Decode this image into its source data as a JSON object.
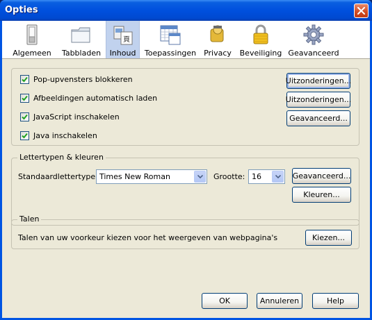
{
  "window": {
    "title": "Opties"
  },
  "tabs": [
    {
      "label": "Algemeen",
      "icon": "switch-icon"
    },
    {
      "label": "Tabbladen",
      "icon": "folder-icon"
    },
    {
      "label": "Inhoud",
      "icon": "content-icon",
      "selected": true
    },
    {
      "label": "Toepassingen",
      "icon": "calendar-icon"
    },
    {
      "label": "Privacy",
      "icon": "mask-icon"
    },
    {
      "label": "Beveiliging",
      "icon": "lock-icon"
    },
    {
      "label": "Geavanceerd",
      "icon": "gear-icon"
    }
  ],
  "content": {
    "popups": {
      "label": "Pop-upvensters blokkeren",
      "checked": true,
      "button": "Uitzonderingen..."
    },
    "images": {
      "label": "Afbeeldingen automatisch laden",
      "checked": true,
      "button": "Uitzonderingen..."
    },
    "javascript": {
      "label": "JavaScript inschakelen",
      "checked": true,
      "button": "Geavanceerd..."
    },
    "java": {
      "label": "Java inschakelen",
      "checked": true
    }
  },
  "fonts": {
    "legend": "Lettertypen & kleuren",
    "default_font_label": "Standaardlettertype:",
    "default_font_value": "Times New Roman",
    "size_label": "Grootte:",
    "size_value": "16",
    "advanced_button": "Geavanceerd...",
    "colors_button": "Kleuren..."
  },
  "languages": {
    "legend": "Talen",
    "description": "Talen van uw voorkeur kiezen voor het weergeven van webpagina's",
    "choose_button": "Kiezen..."
  },
  "footer": {
    "ok": "OK",
    "cancel": "Annuleren",
    "help": "Help"
  },
  "colors": {
    "titlebar": "#0054e3",
    "dialog_bg": "#ece9d8",
    "selected_tab": "#c1d2ee"
  }
}
